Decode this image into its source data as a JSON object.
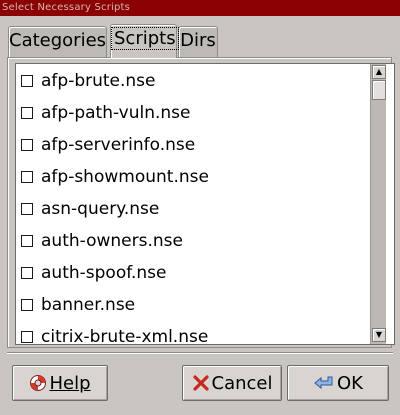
{
  "window": {
    "title": "Select Necessary Scripts"
  },
  "tabs": [
    {
      "label": "Categories",
      "active": false
    },
    {
      "label": "Scripts",
      "active": true
    },
    {
      "label": "Dirs",
      "active": false
    }
  ],
  "scripts": [
    {
      "name": "afp-brute.nse",
      "checked": false
    },
    {
      "name": "afp-path-vuln.nse",
      "checked": false
    },
    {
      "name": "afp-serverinfo.nse",
      "checked": false
    },
    {
      "name": "afp-showmount.nse",
      "checked": false
    },
    {
      "name": "asn-query.nse",
      "checked": false
    },
    {
      "name": "auth-owners.nse",
      "checked": false
    },
    {
      "name": "auth-spoof.nse",
      "checked": false
    },
    {
      "name": "banner.nse",
      "checked": false
    },
    {
      "name": "citrix-brute-xml.nse",
      "checked": false
    }
  ],
  "buttons": {
    "help": {
      "label": "Help",
      "icon": "lifebuoy-icon"
    },
    "cancel": {
      "label": "Cancel",
      "icon": "x-icon"
    },
    "ok": {
      "label": "OK",
      "icon": "enter-arrow-icon"
    }
  },
  "colors": {
    "titlebar": "#8b0000",
    "dialog_bg": "#c9c5c1"
  }
}
